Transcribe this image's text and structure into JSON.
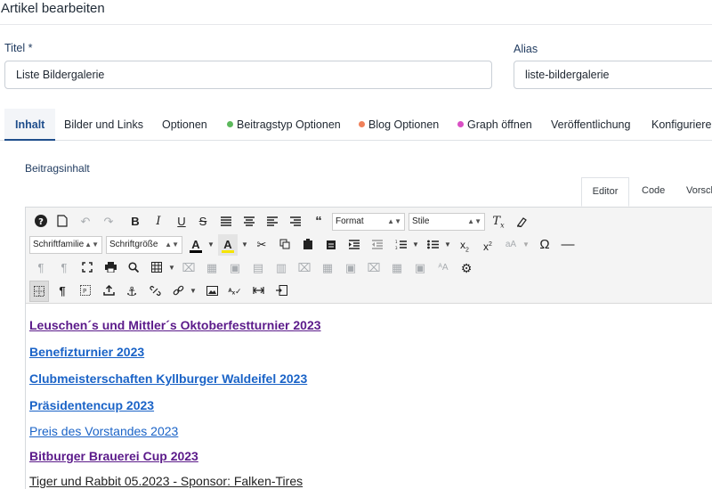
{
  "page": {
    "title": "Artikel bearbeiten"
  },
  "form": {
    "title_label": "Titel *",
    "title_value": "Liste Bildergalerie",
    "alias_label": "Alias",
    "alias_value": "liste-bildergalerie"
  },
  "tabs": [
    {
      "label": "Inhalt"
    },
    {
      "label": "Bilder und Links"
    },
    {
      "label": "Optionen"
    },
    {
      "label": "Beitragstyp Optionen",
      "dot_color": "#5cb85c"
    },
    {
      "label": "Blog Optionen",
      "dot_color": "#f0805a"
    },
    {
      "label": "Graph öffnen",
      "dot_color": "#d94fc4"
    },
    {
      "label": "Veröffentlichung"
    },
    {
      "label": "Konfigurieren"
    }
  ],
  "section": {
    "label": "Beitragsinhalt"
  },
  "editor_tabs": [
    {
      "label": "Editor"
    },
    {
      "label": "Code"
    },
    {
      "label": "Vorsch"
    }
  ],
  "toolbar": {
    "format_select": "Format",
    "stile_select": "Stile",
    "fontfamily_select": "Schriftfamilie",
    "fontsize_select": "Schriftgröße",
    "text_color": "#000000",
    "highlight_color": "#f5e400"
  },
  "content": {
    "lines": [
      {
        "text": "Leuschen´s und Mittler´s Oktoberfestturnier 2023"
      },
      {
        "text": "Benefizturnier 2023"
      },
      {
        "text": "Clubmeisterschaften Kyllburger Waldeifel 2023"
      },
      {
        "text": "Präsidentencup 2023"
      },
      {
        "text": "Preis des Vorstandes 2023"
      },
      {
        "text": "Bitburger Brauerei Cup 2023"
      },
      {
        "text": "Tiger und Rabbit 05.2023 - Sponsor: Falken-Tires"
      }
    ]
  }
}
